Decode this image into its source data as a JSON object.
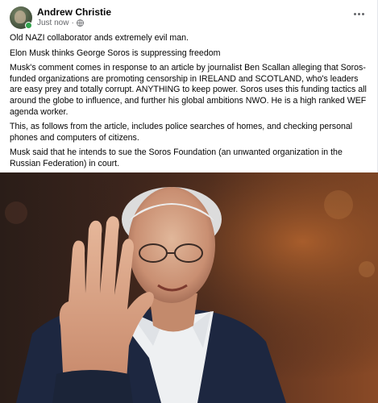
{
  "post": {
    "author": "Andrew Christie",
    "timestamp": "Just now",
    "audience_icon": "globe-icon",
    "more_icon": "ellipsis-icon",
    "paragraphs": [
      "Old NAZI collaborator ands extremely evil man.",
      "Elon Musk thinks George Soros is suppressing freedom",
      "Musk's comment comes in response to an article by journalist Ben Scallan alleging that Soros-funded organizations are promoting censorship in IRELAND and SCOTLAND, who's leaders are easy prey and totally corrupt. ANYTHING to keep power. Soros uses this funding tactics all around the globe to influence, and further his global ambitions NWO. He is a high ranked WEF agenda worker.",
      "This, as follows from the article, includes police searches of homes, and checking personal phones and computers of citizens.",
      "Musk said that he intends to sue the Soros Foundation (an unwanted organization in the Russian Federation) in court."
    ],
    "online_color": "#31a24c"
  }
}
